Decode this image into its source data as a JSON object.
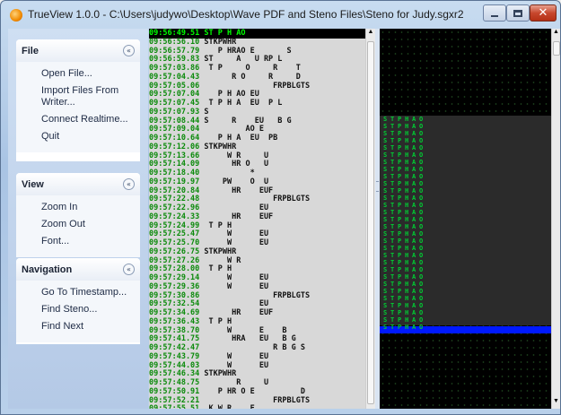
{
  "window": {
    "title": "TrueView 1.0.0 - C:\\Users\\judywo\\Desktop\\Wave PDF and Steno Files\\Steno for Judy.sgxr2",
    "close_glyph": "✕"
  },
  "sidebar": {
    "file": {
      "title": "File",
      "items": [
        "Open File...",
        "Import Files From Writer...",
        "Connect Realtime...",
        "Quit"
      ]
    },
    "view": {
      "title": "View",
      "items": [
        "Zoom In",
        "Zoom Out",
        "Font..."
      ]
    },
    "navigation": {
      "title": "Navigation",
      "items": [
        "Go To Timestamp...",
        "Find Steno...",
        "Find Next"
      ]
    },
    "collapse_glyph": "«"
  },
  "transcript": [
    {
      "ts": "09:56:49.51",
      "st": " ST P H AO",
      "current": true
    },
    {
      "ts": "09:56:56.10",
      "st": " STKPWHR"
    },
    {
      "ts": "09:56:57.79",
      "st": "    P HRAO E       S"
    },
    {
      "ts": "09:56:59.83",
      "st": " ST     A   U RP L"
    },
    {
      "ts": "09:57:03.86",
      "st": "  T P     O     R    T"
    },
    {
      "ts": "09:57:04.43",
      "st": "       R O     R     D"
    },
    {
      "ts": "09:57:05.06",
      "st": "                FRPBLGTS"
    },
    {
      "ts": "09:57:07.04",
      "st": "    P H AO EU"
    },
    {
      "ts": "09:57:07.45",
      "st": "  T P H A  EU  P L"
    },
    {
      "ts": "09:57:07.93",
      "st": " S"
    },
    {
      "ts": "09:57:08.44",
      "st": " S     R    EU   B G"
    },
    {
      "ts": "09:57:09.04",
      "st": "          AO E"
    },
    {
      "ts": "09:57:10.64",
      "st": "    P H A  EU  PB"
    },
    {
      "ts": "09:57:12.06",
      "st": " STKPWHR"
    },
    {
      "ts": "09:57:13.66",
      "st": "      W R     U"
    },
    {
      "ts": "09:57:14.09",
      "st": "       HR O   U"
    },
    {
      "ts": "09:57:18.40",
      "st": "           *"
    },
    {
      "ts": "09:57:19.97",
      "st": "     PW    O  U"
    },
    {
      "ts": "09:57:20.84",
      "st": "       HR    EUF"
    },
    {
      "ts": "09:57:22.48",
      "st": "                FRPBLGTS"
    },
    {
      "ts": "09:57:22.96",
      "st": "             EU"
    },
    {
      "ts": "09:57:24.33",
      "st": "       HR    EUF"
    },
    {
      "ts": "09:57:24.99",
      "st": "  T P H"
    },
    {
      "ts": "09:57:25.47",
      "st": "      W      EU"
    },
    {
      "ts": "09:57:25.70",
      "st": "      W      EU"
    },
    {
      "ts": "09:57:26.75",
      "st": " STKPWHR"
    },
    {
      "ts": "09:57:27.26",
      "st": "      W R"
    },
    {
      "ts": "09:57:28.00",
      "st": "  T P H"
    },
    {
      "ts": "09:57:29.14",
      "st": "      W      EU"
    },
    {
      "ts": "09:57:29.36",
      "st": "      W      EU"
    },
    {
      "ts": "09:57:30.86",
      "st": "                FRPBLGTS"
    },
    {
      "ts": "09:57:32.54",
      "st": "             EU"
    },
    {
      "ts": "09:57:34.69",
      "st": "       HR    EUF"
    },
    {
      "ts": "09:57:36.43",
      "st": "  T P H"
    },
    {
      "ts": "09:57:38.70",
      "st": "      W      E    B"
    },
    {
      "ts": "09:57:41.75",
      "st": "       HRA   EU   B G"
    },
    {
      "ts": "09:57:42.47",
      "st": "                R B G S"
    },
    {
      "ts": "09:57:43.79",
      "st": "      W      EU"
    },
    {
      "ts": "09:57:44.03",
      "st": "      W      EU"
    },
    {
      "ts": "09:57:46.34",
      "st": " STKPWHR"
    },
    {
      "ts": "09:57:48.75",
      "st": "        R     U"
    },
    {
      "ts": "09:57:50.91",
      "st": "    P HR O E          D"
    },
    {
      "ts": "09:57:52.21",
      "st": "                FRPBLGTS"
    },
    {
      "ts": "09:57:55.51",
      "st": "  K W R    E"
    }
  ],
  "tape_columns": [
    "S",
    "T",
    "P",
    "H",
    "A",
    "O"
  ],
  "scroll_glyphs": {
    "up": "▲",
    "down": "▼"
  }
}
